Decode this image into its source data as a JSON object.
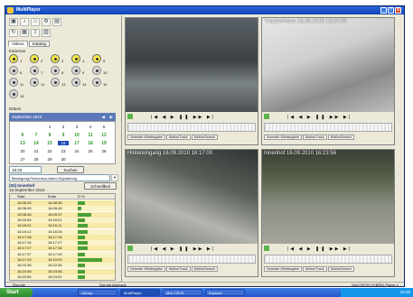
{
  "window": {
    "title": "MultiPlayer",
    "min": "_",
    "max": "□",
    "close": "x"
  },
  "sidebar": {
    "tabs": [
      "Videos",
      "Katalog"
    ],
    "cameras_label": "Kameras",
    "cameras": [
      {
        "num": "1",
        "on": true
      },
      {
        "num": "2",
        "on": true
      },
      {
        "num": "3",
        "on": true
      },
      {
        "num": "4",
        "on": true
      },
      {
        "num": "5",
        "on": true
      },
      {
        "num": "6",
        "on": false
      },
      {
        "num": "7",
        "on": false
      },
      {
        "num": "8",
        "on": false
      },
      {
        "num": "9",
        "on": false
      },
      {
        "num": "10",
        "on": false
      },
      {
        "num": "11",
        "on": false
      },
      {
        "num": "12",
        "on": false
      },
      {
        "num": "13",
        "on": false
      },
      {
        "num": "14",
        "on": false
      },
      {
        "num": "15",
        "on": false
      },
      {
        "num": "16",
        "on": false
      }
    ],
    "date_label": "Datum",
    "calendar": {
      "month": "September 2010",
      "weeks": [
        [
          "",
          "",
          "1",
          "2",
          "3",
          "4",
          "5"
        ],
        [
          "6",
          "7",
          "8",
          "9",
          "10",
          "11",
          "12"
        ],
        [
          "13",
          "14",
          "15",
          "16",
          "17",
          "18",
          "19"
        ],
        [
          "20",
          "21",
          "22",
          "23",
          "24",
          "25",
          "26"
        ],
        [
          "27",
          "28",
          "29",
          "30",
          "",
          "",
          ""
        ]
      ],
      "selected": "16"
    },
    "time_value": "18:25",
    "search_button": "Suchen",
    "filter_value": "Bewegung,Personenz,Alarm,Signalereig",
    "stream_label": "[02] Innenhof",
    "stream_date": "16.September 2010",
    "jump_button": "Schnellbeit",
    "table_headers": [
      "Start",
      "Ende",
      "D %"
    ],
    "events": [
      {
        "start": "16:08:28",
        "end": "16:08:36",
        "pct": 0.2
      },
      {
        "start": "16:08:45",
        "end": "16:08:48",
        "pct": 0.1
      },
      {
        "start": "16:08:48",
        "end": "16:09:37",
        "pct": 0.4
      },
      {
        "start": "16:15:55",
        "end": "16:16:01",
        "pct": 0.2
      },
      {
        "start": "16:16:01",
        "end": "16:16:11",
        "pct": 0.3
      },
      {
        "start": "16:16:12",
        "end": "16:16:25",
        "pct": 0.3
      },
      {
        "start": "16:17:08",
        "end": "16:17:16",
        "pct": 0.2
      },
      {
        "start": "16:17:16",
        "end": "16:17:27",
        "pct": 0.3
      },
      {
        "start": "16:17:27",
        "end": "16:17:36",
        "pct": 0.3
      },
      {
        "start": "16:17:37",
        "end": "16:17:43",
        "pct": 0.2
      },
      {
        "start": "16:17:43",
        "end": "16:19:02",
        "pct": 0.7
      },
      {
        "start": "16:22:36",
        "end": "16:22:46",
        "pct": 0.2
      },
      {
        "start": "16:23:48",
        "end": "16:23:56",
        "pct": 0.2
      },
      {
        "start": "16:23:56",
        "end": "16:24:02",
        "pct": 0.2
      }
    ]
  },
  "panes": [
    {
      "label": "",
      "mode_tabs": [
        "Normale Wiedergabe",
        "MotionTrack",
        "MotionSearch"
      ]
    },
    {
      "label": "Treppenhaus 16.09.2010 16:24:03",
      "mode_tabs": [
        "Normale Wiedergabe",
        "MotionTrack",
        "MotionSearch"
      ]
    },
    {
      "label": "Hintereingang 16.09.2010 16:17:00",
      "mode_tabs": [
        "Normale Wiedergabe",
        "MotionTrack",
        "MotionSearch"
      ]
    },
    {
      "label": "Innenhof 16.09.2010 16:23:56",
      "mode_tabs": [
        "Normale Wiedergabe",
        "MotionTrack",
        "MotionSearch"
      ]
    }
  ],
  "controls_glyphs": "|◀ ◀ ▶ ❚❚ ▶▶ ▶|",
  "statusbar": {
    "left": "Remote",
    "mid": "Normal playback",
    "right": "MULTIEYE HYBRID Player 1"
  },
  "taskbar": {
    "start": "Start",
    "tasks": [
      "Library",
      "MultiPlayer",
      "MULTIEYE",
      "Explorer"
    ],
    "clock": "16:39"
  }
}
